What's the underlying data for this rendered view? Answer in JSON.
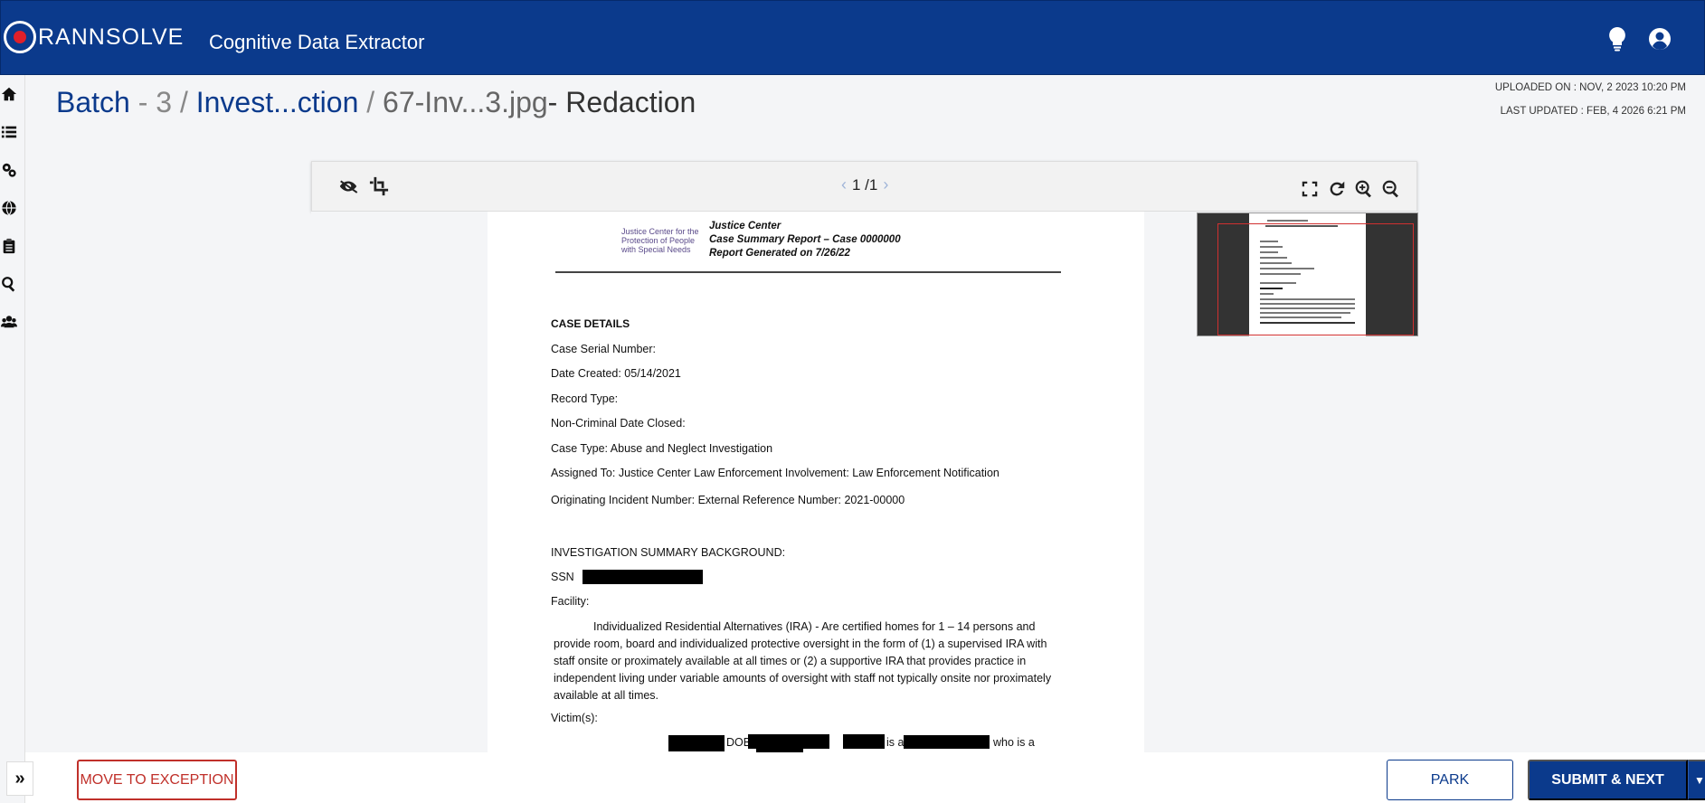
{
  "header": {
    "logo_text": "RANNSOLVE",
    "app_title": "Cognitive Data Extractor",
    "icons": [
      "lightbulb-icon",
      "user-account-icon"
    ]
  },
  "sidebar": {
    "items": [
      "home-icon",
      "list-icon",
      "settings-cogs-icon",
      "globe-icon",
      "clipboard-icon",
      "search-icon",
      "users-icon"
    ]
  },
  "breadcrumb": {
    "batch": "Batch",
    "batch_num": "- 3",
    "sep": "/",
    "folder": "Invest...ction",
    "file": "67-Inv...3.jpg",
    "mode": "- Redaction"
  },
  "meta": {
    "uploaded": "UPLOADED ON : NOV, 2 2023 10:20 PM",
    "updated": "LAST UPDATED : FEB, 4 2026 6:21 PM"
  },
  "viewer": {
    "page_indicator": "1 /1",
    "left_tools": [
      "hide-redaction-icon",
      "crop-icon"
    ],
    "right_tools": [
      "fullscreen-icon",
      "rotate-icon",
      "zoom-in-icon",
      "zoom-out-icon"
    ]
  },
  "document": {
    "logo_lines": [
      "Justice Center for the",
      "Protection of People",
      "with Special Needs"
    ],
    "header_lines": [
      "Justice Center",
      "Case Summary Report – Case 0000000",
      "Report Generated on 7/26/22"
    ],
    "lines": [
      "CASE DETAILS",
      "Case Serial Number:",
      "Date Created: 05/14/2021",
      "Record Type:",
      "Non-Criminal Date Closed:",
      "Case Type: Abuse and Neglect Investigation",
      "Assigned To: Justice Center Law Enforcement Involvement: Law Enforcement Notification",
      "Originating Incident Number: External Reference Number: 2021-00000",
      "INVESTIGATION SUMMARY BACKGROUND:",
      "SSN",
      "Facility:"
    ],
    "paragraph": "Individualized Residential Alternatives (IRA) - Are certified homes for 1 – 14 persons and provide room, board and individualized protective oversight in the form of (1) a supervised IRA with staff onsite or proximately available at all times or (2) a supportive IRA that provides practice in independent living under variable amounts of oversight with staff not typically onsite nor proximately available at all times.",
    "victims_label": "Victim(s):",
    "victim_line": {
      "dob": "DOB",
      "is_a": "is a",
      "who_is_a": "who is a"
    }
  },
  "footer": {
    "exception_label": "MOVE TO EXCEPTION",
    "park_label": "PARK",
    "submit_label": "SUBMIT & NEXT",
    "collapse": "»"
  }
}
